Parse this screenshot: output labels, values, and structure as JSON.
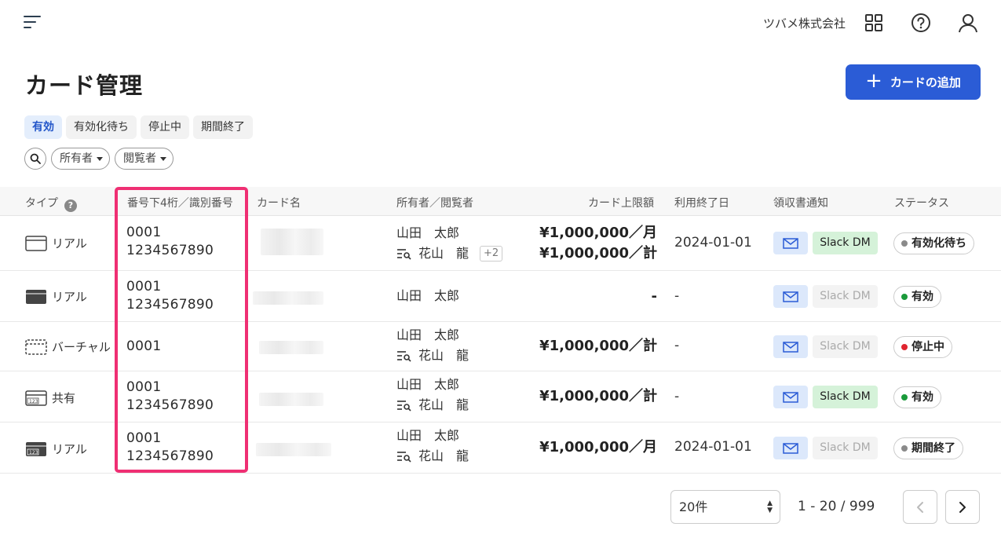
{
  "header": {
    "company": "ツバメ株式会社",
    "icons": [
      "menu-icon",
      "apps-grid-icon",
      "help-circle-icon",
      "user-icon"
    ]
  },
  "page": {
    "title": "カード管理",
    "add_button_label": "カードの追加"
  },
  "tabs": [
    {
      "label": "有効",
      "active": true
    },
    {
      "label": "有効化待ち",
      "active": false
    },
    {
      "label": "停止中",
      "active": false
    },
    {
      "label": "期間終了",
      "active": false
    }
  ],
  "filters": {
    "owner_label": "所有者",
    "viewer_label": "閲覧者"
  },
  "columns": {
    "type": "タイプ",
    "number": "番号下4桁／識別番号",
    "card_name": "カード名",
    "owner_viewer": "所有者／閲覧者",
    "limit": "カード上限額",
    "end_date": "利用終了日",
    "receipt": "領収書通知",
    "status": "ステータス"
  },
  "rows": [
    {
      "type": "リアル",
      "last4": "0001",
      "id_number": "1234567890",
      "owner": "山田　太郎",
      "viewer": "花山　龍",
      "extra_viewers": "+2",
      "limit_month": "¥1,000,000／月",
      "limit_total": "¥1,000,000／計",
      "end_date": "2024-01-01",
      "slack_label": "Slack DM",
      "slack_enabled": true,
      "status": "有効化待ち",
      "status_color": "#8a8a8a"
    },
    {
      "type": "リアル",
      "last4": "0001",
      "id_number": "1234567890",
      "owner": "山田　太郎",
      "limit_total": "-",
      "end_date": "-",
      "slack_label": "Slack DM",
      "slack_enabled": false,
      "status": "有効",
      "status_color": "#1a9a3a"
    },
    {
      "type": "バーチャル",
      "last4": "0001",
      "owner": "山田　太郎",
      "viewer": "花山　龍",
      "limit_total": "¥1,000,000／計",
      "end_date": "-",
      "slack_label": "Slack DM",
      "slack_enabled": false,
      "status": "停止中",
      "status_color": "#e0242f"
    },
    {
      "type": "共有",
      "last4": "0001",
      "id_number": "1234567890",
      "owner": "山田　太郎",
      "viewer": "花山　龍",
      "limit_total": "¥1,000,000／計",
      "end_date": "-",
      "slack_label": "Slack DM",
      "slack_enabled": true,
      "status": "有効",
      "status_color": "#1a9a3a"
    },
    {
      "type": "リアル",
      "last4": "0001",
      "id_number": "1234567890",
      "owner": "山田　太郎",
      "viewer": "花山　龍",
      "limit_month": "¥1,000,000／月",
      "end_date": "2024-01-01",
      "slack_label": "Slack DM",
      "slack_enabled": false,
      "status": "期間終了",
      "status_color": "#8a8a8a"
    }
  ],
  "pagination": {
    "per_page": "20件",
    "range": "1 - 20 / 999"
  },
  "colors": {
    "primary": "#2b5cd6",
    "highlight": "#ef2f73",
    "slack_on": "#d5f2d9",
    "mail_bg": "#dce8fb"
  }
}
